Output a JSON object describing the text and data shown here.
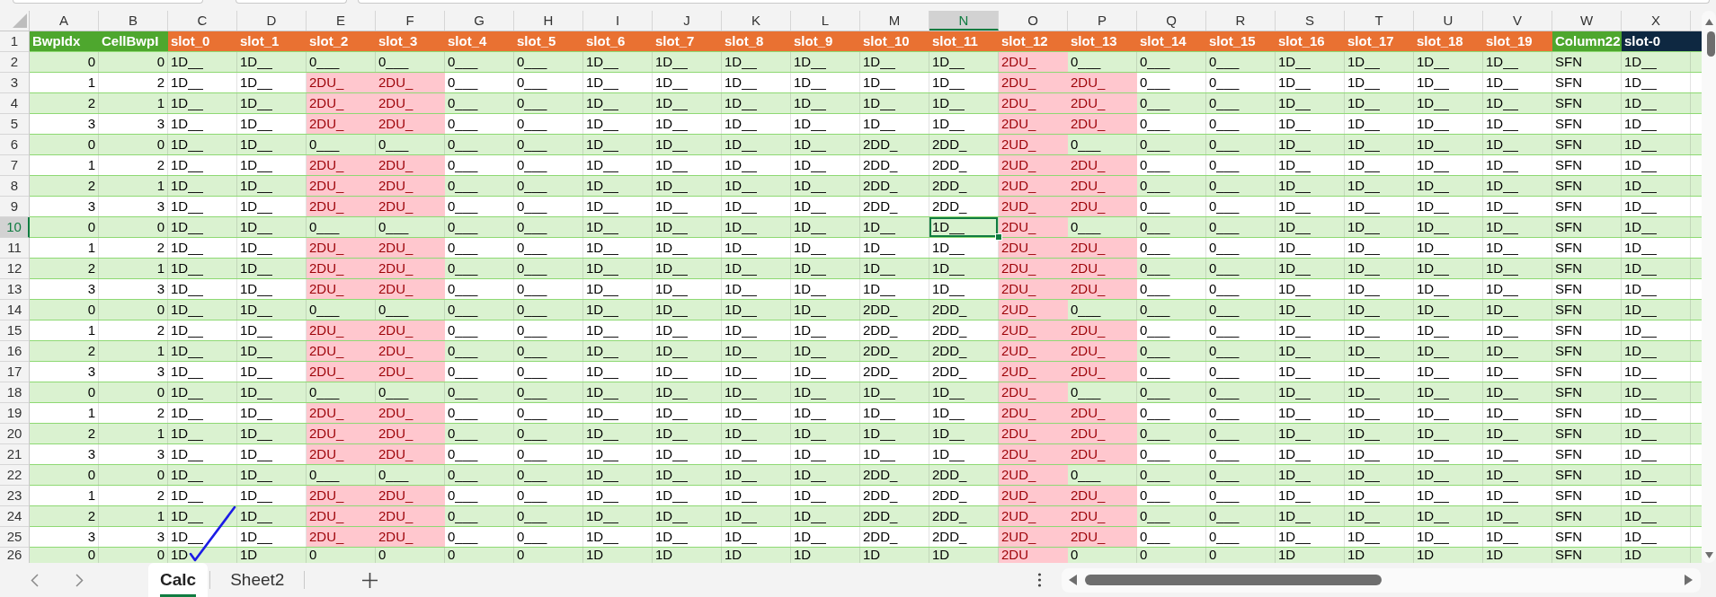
{
  "columns": [
    {
      "letter": "A",
      "title": "BwpIdx",
      "color": "#4ea72e",
      "kind": "number",
      "selected": false
    },
    {
      "letter": "B",
      "title": "CellBwpI",
      "color": "#4ea72e",
      "kind": "number",
      "selected": false
    },
    {
      "letter": "C",
      "title": "slot_0",
      "color": "#e97132",
      "kind": "text",
      "selected": false
    },
    {
      "letter": "D",
      "title": "slot_1",
      "color": "#e97132",
      "kind": "text",
      "selected": false
    },
    {
      "letter": "E",
      "title": "slot_2",
      "color": "#e97132",
      "kind": "text",
      "selected": false
    },
    {
      "letter": "F",
      "title": "slot_3",
      "color": "#e97132",
      "kind": "text",
      "selected": false
    },
    {
      "letter": "G",
      "title": "slot_4",
      "color": "#e97132",
      "kind": "text",
      "selected": false
    },
    {
      "letter": "H",
      "title": "slot_5",
      "color": "#e97132",
      "kind": "text",
      "selected": false
    },
    {
      "letter": "I",
      "title": "slot_6",
      "color": "#e97132",
      "kind": "text",
      "selected": false
    },
    {
      "letter": "J",
      "title": "slot_7",
      "color": "#e97132",
      "kind": "text",
      "selected": false
    },
    {
      "letter": "K",
      "title": "slot_8",
      "color": "#e97132",
      "kind": "text",
      "selected": false
    },
    {
      "letter": "L",
      "title": "slot_9",
      "color": "#e97132",
      "kind": "text",
      "selected": false
    },
    {
      "letter": "M",
      "title": "slot_10",
      "color": "#e97132",
      "kind": "text",
      "selected": false
    },
    {
      "letter": "N",
      "title": "slot_11",
      "color": "#e97132",
      "kind": "text",
      "selected": true
    },
    {
      "letter": "O",
      "title": "slot_12",
      "color": "#e97132",
      "kind": "text",
      "selected": false
    },
    {
      "letter": "P",
      "title": "slot_13",
      "color": "#e97132",
      "kind": "text",
      "selected": false
    },
    {
      "letter": "Q",
      "title": "slot_14",
      "color": "#e97132",
      "kind": "text",
      "selected": false
    },
    {
      "letter": "R",
      "title": "slot_15",
      "color": "#e97132",
      "kind": "text",
      "selected": false
    },
    {
      "letter": "S",
      "title": "slot_16",
      "color": "#e97132",
      "kind": "text",
      "selected": false
    },
    {
      "letter": "T",
      "title": "slot_17",
      "color": "#e97132",
      "kind": "text",
      "selected": false
    },
    {
      "letter": "U",
      "title": "slot_18",
      "color": "#e97132",
      "kind": "text",
      "selected": false
    },
    {
      "letter": "V",
      "title": "slot_19",
      "color": "#e97132",
      "kind": "text",
      "selected": false
    },
    {
      "letter": "W",
      "title": "Column22",
      "color": "#4ea72e",
      "kind": "text",
      "selected": false
    },
    {
      "letter": "X",
      "title": "slot-0",
      "color": "#0e2841",
      "kind": "text",
      "selected": false
    }
  ],
  "header_row": {
    "number": "1"
  },
  "rows": [
    {
      "number": "2",
      "selected": false,
      "cells": [
        "0",
        "0",
        "1D__",
        "1D__",
        "0___",
        "0___",
        "0___",
        "0___",
        "1D__",
        "1D__",
        "1D__",
        "1D__",
        "1D__",
        "1D__",
        "2DU_",
        "0___",
        "0___",
        "0___",
        "1D__",
        "1D__",
        "1D__",
        "1D__",
        "SFN",
        "1D__"
      ],
      "highlighted": [
        false,
        false,
        false,
        false,
        false,
        false,
        false,
        false,
        false,
        false,
        false,
        false,
        false,
        false,
        true,
        false,
        false,
        false,
        false,
        false,
        false,
        false,
        false,
        false
      ]
    },
    {
      "number": "3",
      "selected": false,
      "cells": [
        "1",
        "2",
        "1D__",
        "1D__",
        "2DU_",
        "2DU_",
        "0___",
        "0___",
        "1D__",
        "1D__",
        "1D__",
        "1D__",
        "1D__",
        "1D__",
        "2DU_",
        "2DU_",
        "0___",
        "0___",
        "1D__",
        "1D__",
        "1D__",
        "1D__",
        "SFN",
        "1D__"
      ],
      "highlighted": [
        false,
        false,
        false,
        false,
        true,
        true,
        false,
        false,
        false,
        false,
        false,
        false,
        false,
        false,
        true,
        true,
        false,
        false,
        false,
        false,
        false,
        false,
        false,
        false
      ]
    },
    {
      "number": "4",
      "selected": false,
      "cells": [
        "2",
        "1",
        "1D__",
        "1D__",
        "2DU_",
        "2DU_",
        "0___",
        "0___",
        "1D__",
        "1D__",
        "1D__",
        "1D__",
        "1D__",
        "1D__",
        "2DU_",
        "2DU_",
        "0___",
        "0___",
        "1D__",
        "1D__",
        "1D__",
        "1D__",
        "SFN",
        "1D__"
      ],
      "highlighted": [
        false,
        false,
        false,
        false,
        true,
        true,
        false,
        false,
        false,
        false,
        false,
        false,
        false,
        false,
        true,
        true,
        false,
        false,
        false,
        false,
        false,
        false,
        false,
        false
      ]
    },
    {
      "number": "5",
      "selected": false,
      "cells": [
        "3",
        "3",
        "1D__",
        "1D__",
        "2DU_",
        "2DU_",
        "0___",
        "0___",
        "1D__",
        "1D__",
        "1D__",
        "1D__",
        "1D__",
        "1D__",
        "2DU_",
        "2DU_",
        "0___",
        "0___",
        "1D__",
        "1D__",
        "1D__",
        "1D__",
        "SFN",
        "1D__"
      ],
      "highlighted": [
        false,
        false,
        false,
        false,
        true,
        true,
        false,
        false,
        false,
        false,
        false,
        false,
        false,
        false,
        true,
        true,
        false,
        false,
        false,
        false,
        false,
        false,
        false,
        false
      ]
    },
    {
      "number": "6",
      "selected": false,
      "cells": [
        "0",
        "0",
        "1D__",
        "1D__",
        "0___",
        "0___",
        "0___",
        "0___",
        "1D__",
        "1D__",
        "1D__",
        "1D__",
        "2DD_",
        "2DD_",
        "2UD_",
        "0___",
        "0___",
        "0___",
        "1D__",
        "1D__",
        "1D__",
        "1D__",
        "SFN",
        "1D__"
      ],
      "highlighted": [
        false,
        false,
        false,
        false,
        false,
        false,
        false,
        false,
        false,
        false,
        false,
        false,
        false,
        false,
        true,
        false,
        false,
        false,
        false,
        false,
        false,
        false,
        false,
        false
      ]
    },
    {
      "number": "7",
      "selected": false,
      "cells": [
        "1",
        "2",
        "1D__",
        "1D__",
        "2DU_",
        "2DU_",
        "0___",
        "0___",
        "1D__",
        "1D__",
        "1D__",
        "1D__",
        "2DD_",
        "2DD_",
        "2UD_",
        "2DU_",
        "0___",
        "0___",
        "1D__",
        "1D__",
        "1D__",
        "1D__",
        "SFN",
        "1D__"
      ],
      "highlighted": [
        false,
        false,
        false,
        false,
        true,
        true,
        false,
        false,
        false,
        false,
        false,
        false,
        false,
        false,
        true,
        true,
        false,
        false,
        false,
        false,
        false,
        false,
        false,
        false
      ]
    },
    {
      "number": "8",
      "selected": false,
      "cells": [
        "2",
        "1",
        "1D__",
        "1D__",
        "2DU_",
        "2DU_",
        "0___",
        "0___",
        "1D__",
        "1D__",
        "1D__",
        "1D__",
        "2DD_",
        "2DD_",
        "2UD_",
        "2DU_",
        "0___",
        "0___",
        "1D__",
        "1D__",
        "1D__",
        "1D__",
        "SFN",
        "1D__"
      ],
      "highlighted": [
        false,
        false,
        false,
        false,
        true,
        true,
        false,
        false,
        false,
        false,
        false,
        false,
        false,
        false,
        true,
        true,
        false,
        false,
        false,
        false,
        false,
        false,
        false,
        false
      ]
    },
    {
      "number": "9",
      "selected": false,
      "cells": [
        "3",
        "3",
        "1D__",
        "1D__",
        "2DU_",
        "2DU_",
        "0___",
        "0___",
        "1D__",
        "1D__",
        "1D__",
        "1D__",
        "2DD_",
        "2DD_",
        "2UD_",
        "2DU_",
        "0___",
        "0___",
        "1D__",
        "1D__",
        "1D__",
        "1D__",
        "SFN",
        "1D__"
      ],
      "highlighted": [
        false,
        false,
        false,
        false,
        true,
        true,
        false,
        false,
        false,
        false,
        false,
        false,
        false,
        false,
        true,
        true,
        false,
        false,
        false,
        false,
        false,
        false,
        false,
        false
      ]
    },
    {
      "number": "10",
      "selected": true,
      "cells": [
        "0",
        "0",
        "1D__",
        "1D__",
        "0___",
        "0___",
        "0___",
        "0___",
        "1D__",
        "1D__",
        "1D__",
        "1D__",
        "1D__",
        "1D__",
        "2DU_",
        "0___",
        "0___",
        "0___",
        "1D__",
        "1D__",
        "1D__",
        "1D__",
        "SFN",
        "1D__"
      ],
      "highlighted": [
        false,
        false,
        false,
        false,
        false,
        false,
        false,
        false,
        false,
        false,
        false,
        false,
        false,
        false,
        true,
        false,
        false,
        false,
        false,
        false,
        false,
        false,
        false,
        false
      ]
    },
    {
      "number": "11",
      "selected": false,
      "cells": [
        "1",
        "2",
        "1D__",
        "1D__",
        "2DU_",
        "2DU_",
        "0___",
        "0___",
        "1D__",
        "1D__",
        "1D__",
        "1D__",
        "1D__",
        "1D__",
        "2DU_",
        "2DU_",
        "0___",
        "0___",
        "1D__",
        "1D__",
        "1D__",
        "1D__",
        "SFN",
        "1D__"
      ],
      "highlighted": [
        false,
        false,
        false,
        false,
        true,
        true,
        false,
        false,
        false,
        false,
        false,
        false,
        false,
        false,
        true,
        true,
        false,
        false,
        false,
        false,
        false,
        false,
        false,
        false
      ]
    },
    {
      "number": "12",
      "selected": false,
      "cells": [
        "2",
        "1",
        "1D__",
        "1D__",
        "2DU_",
        "2DU_",
        "0___",
        "0___",
        "1D__",
        "1D__",
        "1D__",
        "1D__",
        "1D__",
        "1D__",
        "2DU_",
        "2DU_",
        "0___",
        "0___",
        "1D__",
        "1D__",
        "1D__",
        "1D__",
        "SFN",
        "1D__"
      ],
      "highlighted": [
        false,
        false,
        false,
        false,
        true,
        true,
        false,
        false,
        false,
        false,
        false,
        false,
        false,
        false,
        true,
        true,
        false,
        false,
        false,
        false,
        false,
        false,
        false,
        false
      ]
    },
    {
      "number": "13",
      "selected": false,
      "cells": [
        "3",
        "3",
        "1D__",
        "1D__",
        "2DU_",
        "2DU_",
        "0___",
        "0___",
        "1D__",
        "1D__",
        "1D__",
        "1D__",
        "1D__",
        "1D__",
        "2DU_",
        "2DU_",
        "0___",
        "0___",
        "1D__",
        "1D__",
        "1D__",
        "1D__",
        "SFN",
        "1D__"
      ],
      "highlighted": [
        false,
        false,
        false,
        false,
        true,
        true,
        false,
        false,
        false,
        false,
        false,
        false,
        false,
        false,
        true,
        true,
        false,
        false,
        false,
        false,
        false,
        false,
        false,
        false
      ]
    },
    {
      "number": "14",
      "selected": false,
      "cells": [
        "0",
        "0",
        "1D__",
        "1D__",
        "0___",
        "0___",
        "0___",
        "0___",
        "1D__",
        "1D__",
        "1D__",
        "1D__",
        "2DD_",
        "2DD_",
        "2UD_",
        "0___",
        "0___",
        "0___",
        "1D__",
        "1D__",
        "1D__",
        "1D__",
        "SFN",
        "1D__"
      ],
      "highlighted": [
        false,
        false,
        false,
        false,
        false,
        false,
        false,
        false,
        false,
        false,
        false,
        false,
        false,
        false,
        true,
        false,
        false,
        false,
        false,
        false,
        false,
        false,
        false,
        false
      ]
    },
    {
      "number": "15",
      "selected": false,
      "cells": [
        "1",
        "2",
        "1D__",
        "1D__",
        "2DU_",
        "2DU_",
        "0___",
        "0___",
        "1D__",
        "1D__",
        "1D__",
        "1D__",
        "2DD_",
        "2DD_",
        "2UD_",
        "2DU_",
        "0___",
        "0___",
        "1D__",
        "1D__",
        "1D__",
        "1D__",
        "SFN",
        "1D__"
      ],
      "highlighted": [
        false,
        false,
        false,
        false,
        true,
        true,
        false,
        false,
        false,
        false,
        false,
        false,
        false,
        false,
        true,
        true,
        false,
        false,
        false,
        false,
        false,
        false,
        false,
        false
      ]
    },
    {
      "number": "16",
      "selected": false,
      "cells": [
        "2",
        "1",
        "1D__",
        "1D__",
        "2DU_",
        "2DU_",
        "0___",
        "0___",
        "1D__",
        "1D__",
        "1D__",
        "1D__",
        "2DD_",
        "2DD_",
        "2UD_",
        "2DU_",
        "0___",
        "0___",
        "1D__",
        "1D__",
        "1D__",
        "1D__",
        "SFN",
        "1D__"
      ],
      "highlighted": [
        false,
        false,
        false,
        false,
        true,
        true,
        false,
        false,
        false,
        false,
        false,
        false,
        false,
        false,
        true,
        true,
        false,
        false,
        false,
        false,
        false,
        false,
        false,
        false
      ]
    },
    {
      "number": "17",
      "selected": false,
      "cells": [
        "3",
        "3",
        "1D__",
        "1D__",
        "2DU_",
        "2DU_",
        "0___",
        "0___",
        "1D__",
        "1D__",
        "1D__",
        "1D__",
        "2DD_",
        "2DD_",
        "2UD_",
        "2DU_",
        "0___",
        "0___",
        "1D__",
        "1D__",
        "1D__",
        "1D__",
        "SFN",
        "1D__"
      ],
      "highlighted": [
        false,
        false,
        false,
        false,
        true,
        true,
        false,
        false,
        false,
        false,
        false,
        false,
        false,
        false,
        true,
        true,
        false,
        false,
        false,
        false,
        false,
        false,
        false,
        false
      ]
    },
    {
      "number": "18",
      "selected": false,
      "cells": [
        "0",
        "0",
        "1D__",
        "1D__",
        "0___",
        "0___",
        "0___",
        "0___",
        "1D__",
        "1D__",
        "1D__",
        "1D__",
        "1D__",
        "1D__",
        "2DU_",
        "0___",
        "0___",
        "0___",
        "1D__",
        "1D__",
        "1D__",
        "1D__",
        "SFN",
        "1D__"
      ],
      "highlighted": [
        false,
        false,
        false,
        false,
        false,
        false,
        false,
        false,
        false,
        false,
        false,
        false,
        false,
        false,
        true,
        false,
        false,
        false,
        false,
        false,
        false,
        false,
        false,
        false
      ]
    },
    {
      "number": "19",
      "selected": false,
      "cells": [
        "1",
        "2",
        "1D__",
        "1D__",
        "2DU_",
        "2DU_",
        "0___",
        "0___",
        "1D__",
        "1D__",
        "1D__",
        "1D__",
        "1D__",
        "1D__",
        "2DU_",
        "2DU_",
        "0___",
        "0___",
        "1D__",
        "1D__",
        "1D__",
        "1D__",
        "SFN",
        "1D__"
      ],
      "highlighted": [
        false,
        false,
        false,
        false,
        true,
        true,
        false,
        false,
        false,
        false,
        false,
        false,
        false,
        false,
        true,
        true,
        false,
        false,
        false,
        false,
        false,
        false,
        false,
        false
      ]
    },
    {
      "number": "20",
      "selected": false,
      "cells": [
        "2",
        "1",
        "1D__",
        "1D__",
        "2DU_",
        "2DU_",
        "0___",
        "0___",
        "1D__",
        "1D__",
        "1D__",
        "1D__",
        "1D__",
        "1D__",
        "2DU_",
        "2DU_",
        "0___",
        "0___",
        "1D__",
        "1D__",
        "1D__",
        "1D__",
        "SFN",
        "1D__"
      ],
      "highlighted": [
        false,
        false,
        false,
        false,
        true,
        true,
        false,
        false,
        false,
        false,
        false,
        false,
        false,
        false,
        true,
        true,
        false,
        false,
        false,
        false,
        false,
        false,
        false,
        false
      ]
    },
    {
      "number": "21",
      "selected": false,
      "cells": [
        "3",
        "3",
        "1D__",
        "1D__",
        "2DU_",
        "2DU_",
        "0___",
        "0___",
        "1D__",
        "1D__",
        "1D__",
        "1D__",
        "1D__",
        "1D__",
        "2DU_",
        "2DU_",
        "0___",
        "0___",
        "1D__",
        "1D__",
        "1D__",
        "1D__",
        "SFN",
        "1D__"
      ],
      "highlighted": [
        false,
        false,
        false,
        false,
        true,
        true,
        false,
        false,
        false,
        false,
        false,
        false,
        false,
        false,
        true,
        true,
        false,
        false,
        false,
        false,
        false,
        false,
        false,
        false
      ]
    },
    {
      "number": "22",
      "selected": false,
      "cells": [
        "0",
        "0",
        "1D__",
        "1D__",
        "0___",
        "0___",
        "0___",
        "0___",
        "1D__",
        "1D__",
        "1D__",
        "1D__",
        "2DD_",
        "2DD_",
        "2UD_",
        "0___",
        "0___",
        "0___",
        "1D__",
        "1D__",
        "1D__",
        "1D__",
        "SFN",
        "1D__"
      ],
      "highlighted": [
        false,
        false,
        false,
        false,
        false,
        false,
        false,
        false,
        false,
        false,
        false,
        false,
        false,
        false,
        true,
        false,
        false,
        false,
        false,
        false,
        false,
        false,
        false,
        false
      ]
    },
    {
      "number": "23",
      "selected": false,
      "cells": [
        "1",
        "2",
        "1D__",
        "1D__",
        "2DU_",
        "2DU_",
        "0___",
        "0___",
        "1D__",
        "1D__",
        "1D__",
        "1D__",
        "2DD_",
        "2DD_",
        "2UD_",
        "2DU_",
        "0___",
        "0___",
        "1D__",
        "1D__",
        "1D__",
        "1D__",
        "SFN",
        "1D__"
      ],
      "highlighted": [
        false,
        false,
        false,
        false,
        true,
        true,
        false,
        false,
        false,
        false,
        false,
        false,
        false,
        false,
        true,
        true,
        false,
        false,
        false,
        false,
        false,
        false,
        false,
        false
      ]
    },
    {
      "number": "24",
      "selected": false,
      "cells": [
        "2",
        "1",
        "1D__",
        "1D__",
        "2DU_",
        "2DU_",
        "0___",
        "0___",
        "1D__",
        "1D__",
        "1D__",
        "1D__",
        "2DD_",
        "2DD_",
        "2UD_",
        "2DU_",
        "0___",
        "0___",
        "1D__",
        "1D__",
        "1D__",
        "1D__",
        "SFN",
        "1D__"
      ],
      "highlighted": [
        false,
        false,
        false,
        false,
        true,
        true,
        false,
        false,
        false,
        false,
        false,
        false,
        false,
        false,
        true,
        true,
        false,
        false,
        false,
        false,
        false,
        false,
        false,
        false
      ]
    },
    {
      "number": "25",
      "selected": false,
      "cells": [
        "3",
        "3",
        "1D__",
        "1D__",
        "2DU_",
        "2DU_",
        "0___",
        "0___",
        "1D__",
        "1D__",
        "1D__",
        "1D__",
        "2DD_",
        "2DD_",
        "2UD_",
        "2DU_",
        "0___",
        "0___",
        "1D__",
        "1D__",
        "1D__",
        "1D__",
        "SFN",
        "1D__"
      ],
      "highlighted": [
        false,
        false,
        false,
        false,
        true,
        true,
        false,
        false,
        false,
        false,
        false,
        false,
        false,
        false,
        true,
        true,
        false,
        false,
        false,
        false,
        false,
        false,
        false,
        false
      ]
    },
    {
      "number": "26",
      "selected": false,
      "cells": [
        "0",
        "0",
        "1D",
        "1D",
        "0",
        "0",
        "0",
        "0",
        "1D",
        "1D",
        "1D",
        "1D",
        "1D",
        "1D",
        "2DU",
        "0",
        "0",
        "0",
        "1D",
        "1D",
        "1D",
        "1D",
        "SFN",
        "1D"
      ],
      "highlighted": [
        false,
        false,
        false,
        false,
        false,
        false,
        false,
        false,
        false,
        false,
        false,
        false,
        false,
        false,
        true,
        false,
        false,
        false,
        false,
        false,
        false,
        false,
        false,
        false
      ]
    }
  ],
  "sheet_tabs": [
    {
      "label": "Calc",
      "selected": true
    },
    {
      "label": "Sheet2",
      "selected": false
    }
  ]
}
